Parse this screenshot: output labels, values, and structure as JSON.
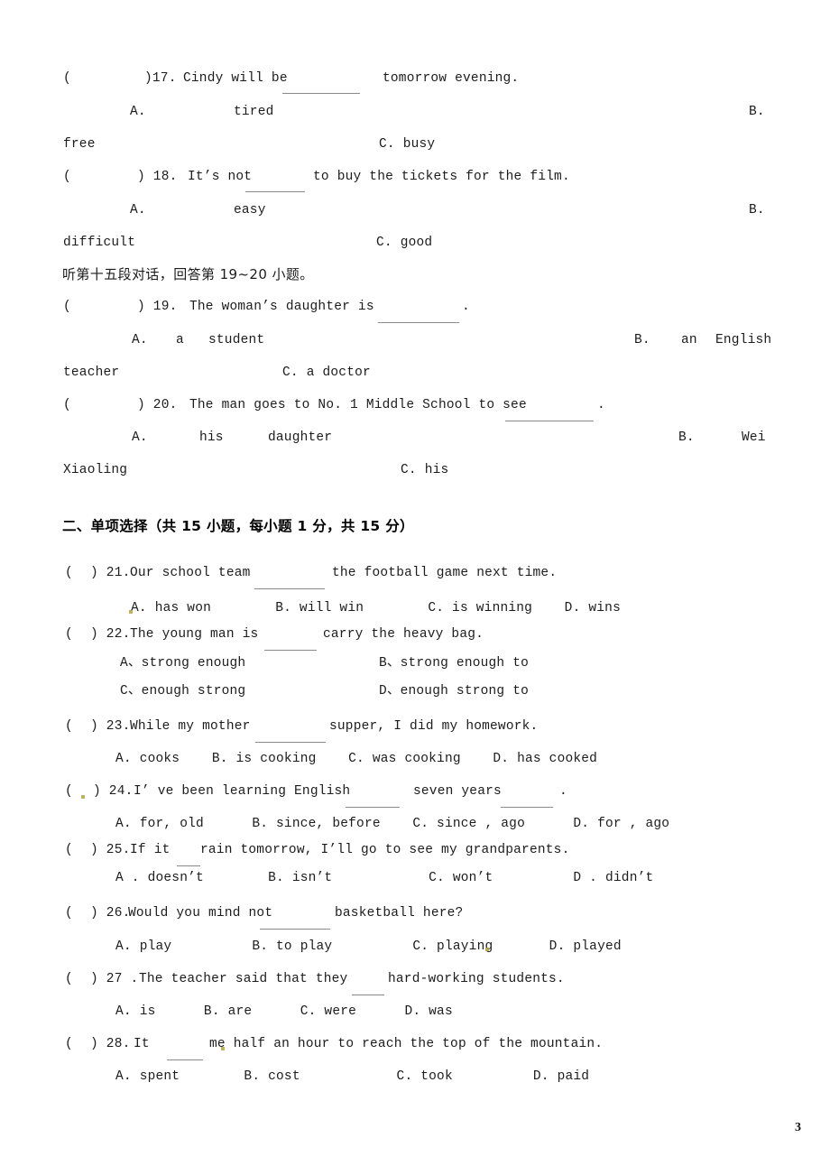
{
  "document": {
    "page_number": "3"
  },
  "listening_section": {
    "q17": {
      "marker": "(",
      "marker_close": ")17.",
      "stem_before": "Cindy will be",
      "stem_after": "tomorrow evening.",
      "optA_label": "A.",
      "optA_text": "tired",
      "optB_label": "B.",
      "optB_text": "free",
      "optC": "C. busy"
    },
    "q18": {
      "marker": "(",
      "marker_close": ") 18.",
      "stem_before": "It’s not",
      "stem_after": "to buy the tickets for the film.",
      "optA_label": "A.",
      "optA_text": "easy",
      "optB_label": "B.",
      "optB_text": "difficult",
      "optC": "C. good"
    },
    "instruction": "听第十五段对话，回答第 19~20 小题。",
    "q19": {
      "marker": "(",
      "marker_close": ") 19.",
      "stem_before": "The woman’s daughter is",
      "stem_after": ".",
      "optA_label": "A.",
      "optA_a": "a",
      "optA_text": "student",
      "optB_label": "B.",
      "optB_an": "an",
      "optB_text": "English",
      "optB_cont": "teacher",
      "optC": "C. a doctor"
    },
    "q20": {
      "marker": "(",
      "marker_close": ") 20.",
      "stem_before": "The man goes to No. 1 Middle School to see",
      "stem_after": ".",
      "optA_label": "A.",
      "optA_his": "his",
      "optA_text": "daughter",
      "optB_label": "B.",
      "optB_text": "Wei",
      "optB_cont": "Xiaoling",
      "optC": "C. his"
    }
  },
  "multiple_choice_section": {
    "heading": "二、单项选择（共 15 小题，每小题 1 分，共 15 分）",
    "questions": [
      {
        "id": 21,
        "open": "(",
        "close": ") 21.",
        "stem_before": "Our school team",
        "stem_after": "the football game next time.",
        "options_line": "A. has won        B. will win        C. is winning    D. wins"
      },
      {
        "id": 22,
        "open": "(",
        "close": ") 22.",
        "stem_before": "The young man is",
        "stem_after": "carry the heavy bag.",
        "options_row1_left": "A、strong enough",
        "options_row1_right": "B、strong enough to",
        "options_row2_left": "C、enough strong",
        "options_row2_right": "D、enough strong to"
      },
      {
        "id": 23,
        "open": "(",
        "close": ") 23.",
        "stem_before": "While my mother",
        "stem_after": "supper, I did my homework.",
        "options_line": "A. cooks    B. is cooking    C. was cooking    D. has cooked"
      },
      {
        "id": 24,
        "open": "(",
        "close": ") 24.",
        "stem_before": "I’ ve been learning English",
        "stem_mid": "seven years",
        "stem_after": ".",
        "options_line": "A. for, old      B. since, before    C. since , ago      D. for , ago"
      },
      {
        "id": 25,
        "open": "(",
        "close": ") 25.",
        "stem_before": "If it",
        "stem_after": "rain tomorrow, I’ll go to see my grandparents.",
        "options_line": "A . doesn’t        B. isn’t            C. won’t          D . didn’t"
      },
      {
        "id": 26,
        "open": "(",
        "close": ") 26.",
        "stem_before": "Would you mind not",
        "stem_after": "basketball here?",
        "options_line": "A. play          B. to play          C. playing       D. played"
      },
      {
        "id": 27,
        "open": "(",
        "close": ") 27 .",
        "stem_before": "The teacher said that they",
        "stem_after": "hard-working students.",
        "options_line": "A. is      B. are      C. were      D. was"
      },
      {
        "id": 28,
        "open": "(",
        "close": ") 28.",
        "stem_before": "It",
        "stem_after": "me half an hour to reach the top of the mountain.",
        "options_line": "A. spent        B. cost            C. took          D. paid"
      }
    ]
  }
}
